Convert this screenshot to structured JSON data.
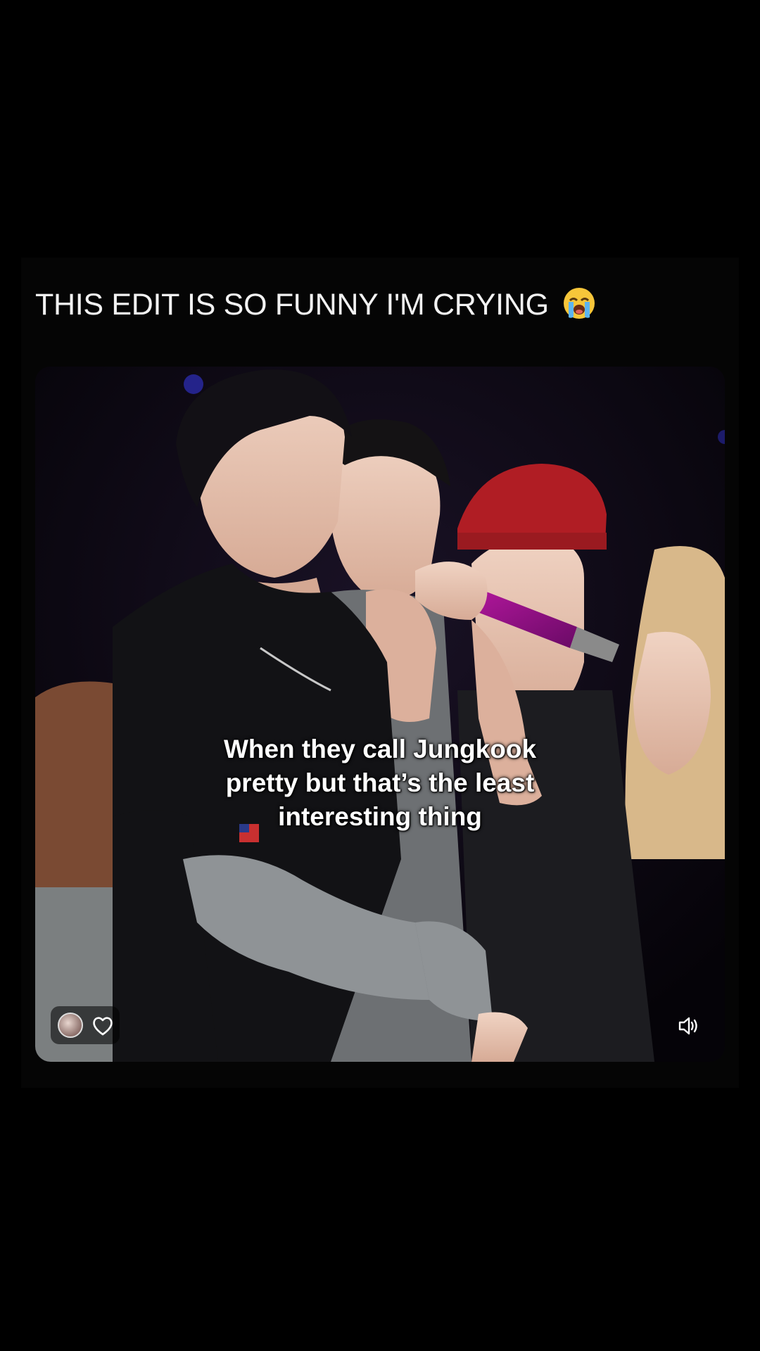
{
  "post": {
    "caption": "THIS EDIT IS SO FUNNY I'M CRYING",
    "caption_emoji": "loudly-crying-face-emoji",
    "video": {
      "overlay_lines": [
        "When they call Jungkook",
        "pretty but that’s the least",
        "interesting thing"
      ]
    },
    "controls": {
      "avatar_icon": "user-avatar-icon",
      "heart_icon": "heart-outline-icon",
      "volume_icon": "speaker-volume-icon"
    }
  }
}
